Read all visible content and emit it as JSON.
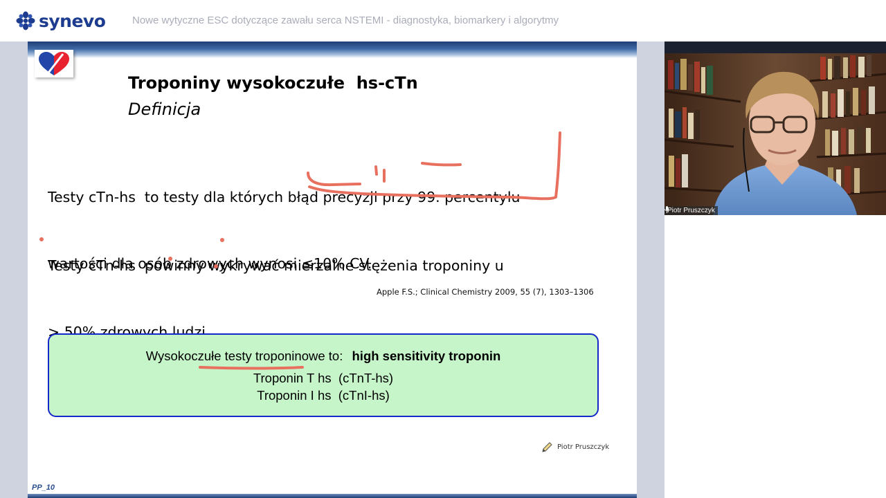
{
  "header": {
    "logo_text": "synevo",
    "webinar_title": "Nowe wytyczne ESC dotyczące zawału serca NSTEMI - diagnostyka, biomarkery i algorytmy"
  },
  "slide": {
    "title": "Troponiny wysokoczułe  hs-cTn",
    "subtitle": "Definicja",
    "para1": {
      "line1": "Testy cTn-hs  to testy dla których błąd precyzji przy 99. percentylu",
      "line2": "wartości dla osób zdrowych wynosi ≤10% CV."
    },
    "para2": {
      "line1": "Testy cTn-hs  powinny wykrywać mierzalne stężenia troponiny u",
      "line2": "> 50% zdrowych ludzi."
    },
    "citation": "Apple F.S.; Clinical Chemistry 2009, 55 (7), 1303–1306",
    "box": {
      "line1_regular": "Wysokoczułe testy troponinowe to:",
      "line1_bold": "high sensitivity troponin",
      "line2": "Troponin T hs  (cTnT-hs)",
      "line3": "Troponin I hs  (cTnI-hs)"
    },
    "author": "Piotr Pruszczyk",
    "slide_id": "PP_10",
    "annotation_color": "#e8705f"
  },
  "video": {
    "participant_name": "Piotr Pruszczyk"
  },
  "colors": {
    "brand": "#1d3c8f",
    "stage_bg": "#cfd3e0",
    "box_fill": "#c6f5c9",
    "box_border": "#1427c8"
  }
}
